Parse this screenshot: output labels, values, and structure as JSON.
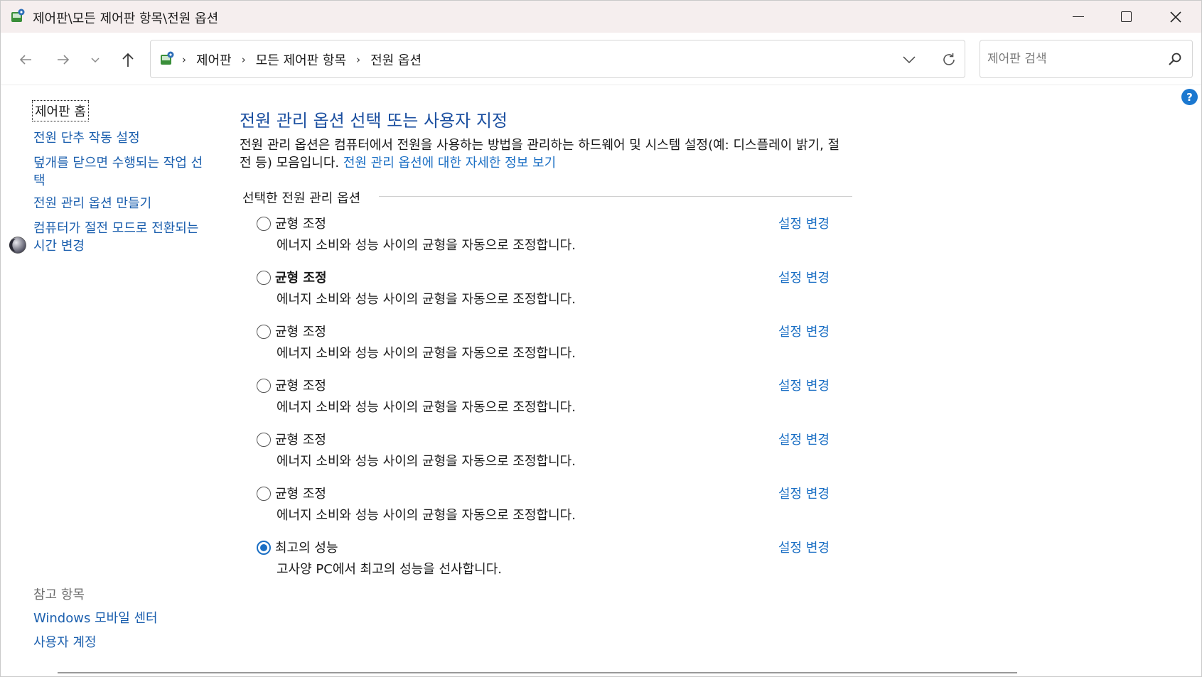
{
  "window": {
    "title": "제어판\\모든 제어판 항목\\전원 옵션",
    "controls": [
      "minimize",
      "maximize",
      "close"
    ]
  },
  "navigation": {
    "breadcrumbs": [
      "제어판",
      "모든 제어판 항목",
      "전원 옵션"
    ],
    "search_placeholder": "제어판 검색"
  },
  "left_pane": {
    "home": "제어판 홈",
    "tasks": [
      "전원 단추 작동 설정",
      "덮개를 닫으면 수행되는 작업 선택",
      "전원 관리 옵션 만들기",
      "컴퓨터가 절전 모드로 전환되는 시간 변경"
    ],
    "see_also_title": "참고 항목",
    "see_also": [
      "Windows 모바일 센터",
      "사용자 계정"
    ]
  },
  "main": {
    "heading": "전원 관리 옵션 선택 또는 사용자 지정",
    "description": "전원 관리 옵션은 컴퓨터에서 전원을 사용하는 방법을 관리하는 하드웨어 및 시스템 설정(예: 디스플레이 밝기, 절전 등) 모음입니다. ",
    "more_info_link": "전원 관리 옵션에 대한 자세한 정보 보기",
    "group_label": "선택한 전원 관리 옵션",
    "change_label": "설정 변경",
    "plans": [
      {
        "name": "균형 조정",
        "description": "에너지 소비와 성능 사이의 균형을 자동으로 조정합니다.",
        "selected": false,
        "bold": false
      },
      {
        "name": "균형 조정",
        "description": "에너지 소비와 성능 사이의 균형을 자동으로 조정합니다.",
        "selected": false,
        "bold": true
      },
      {
        "name": "균형 조정",
        "description": "에너지 소비와 성능 사이의 균형을 자동으로 조정합니다.",
        "selected": false,
        "bold": false
      },
      {
        "name": "균형 조정",
        "description": "에너지 소비와 성능 사이의 균형을 자동으로 조정합니다.",
        "selected": false,
        "bold": false
      },
      {
        "name": "균형 조정",
        "description": "에너지 소비와 성능 사이의 균형을 자동으로 조정합니다.",
        "selected": false,
        "bold": false
      },
      {
        "name": "균형 조정",
        "description": "에너지 소비와 성능 사이의 균형을 자동으로 조정합니다.",
        "selected": false,
        "bold": false
      },
      {
        "name": "최고의 성능",
        "description": "고사양 PC에서 최고의 성능을 선사합니다.",
        "selected": true,
        "bold": false
      }
    ]
  },
  "colors": {
    "link": "#1b6fc4",
    "heading": "#1b4fa0",
    "titlebar": "#f5eeee"
  }
}
